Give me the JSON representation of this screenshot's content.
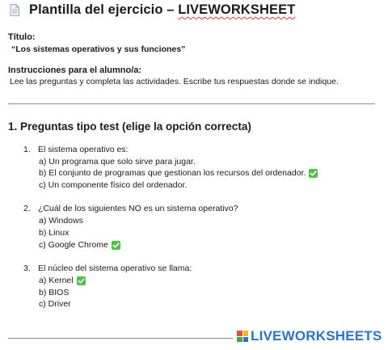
{
  "header": {
    "title_prefix": "Plantilla del ejercicio – ",
    "title_brand": "LIVEWORKSHEET"
  },
  "titulo": {
    "label": "Título:",
    "value": "“Los sistemas operativos y sus funciones”"
  },
  "instrucciones": {
    "label": "Instrucciones para el alumno/a:",
    "text": "Lee las preguntas y completa las actividades. Escribe tus respuestas donde se indique."
  },
  "section1": {
    "heading": "1. Preguntas tipo test (elige la opción correcta)"
  },
  "questions": [
    {
      "number": "1.",
      "text": "El sistema operativo es:",
      "options": [
        {
          "text": "a) Un programa que solo sirve para jugar.",
          "correct": false
        },
        {
          "text": "b) El conjunto de programas que gestionan los recursos del ordenador.",
          "correct": true
        },
        {
          "text": "c) Un componente físico del ordenador.",
          "correct": false
        }
      ]
    },
    {
      "number": "2.",
      "text": "¿Cuál de los siguientes NO es un sistema operativo?",
      "options": [
        {
          "text": "a) Windows",
          "correct": false
        },
        {
          "text": "b) Linux",
          "correct": false
        },
        {
          "text": "c) Google Chrome",
          "correct": true
        }
      ]
    },
    {
      "number": "3.",
      "text": "El núcleo del sistema operativo se llama:",
      "options": [
        {
          "text": "a) Kernel",
          "correct": true
        },
        {
          "text": "b) BIOS",
          "correct": false
        },
        {
          "text": "c) Driver",
          "correct": false
        }
      ]
    }
  ],
  "footer": {
    "brand": "LIVEWORKSHEETS"
  },
  "colors": {
    "check": "#4fc04a",
    "brand_blue": "#2a73c9",
    "underline_red": "#d23b3b"
  }
}
